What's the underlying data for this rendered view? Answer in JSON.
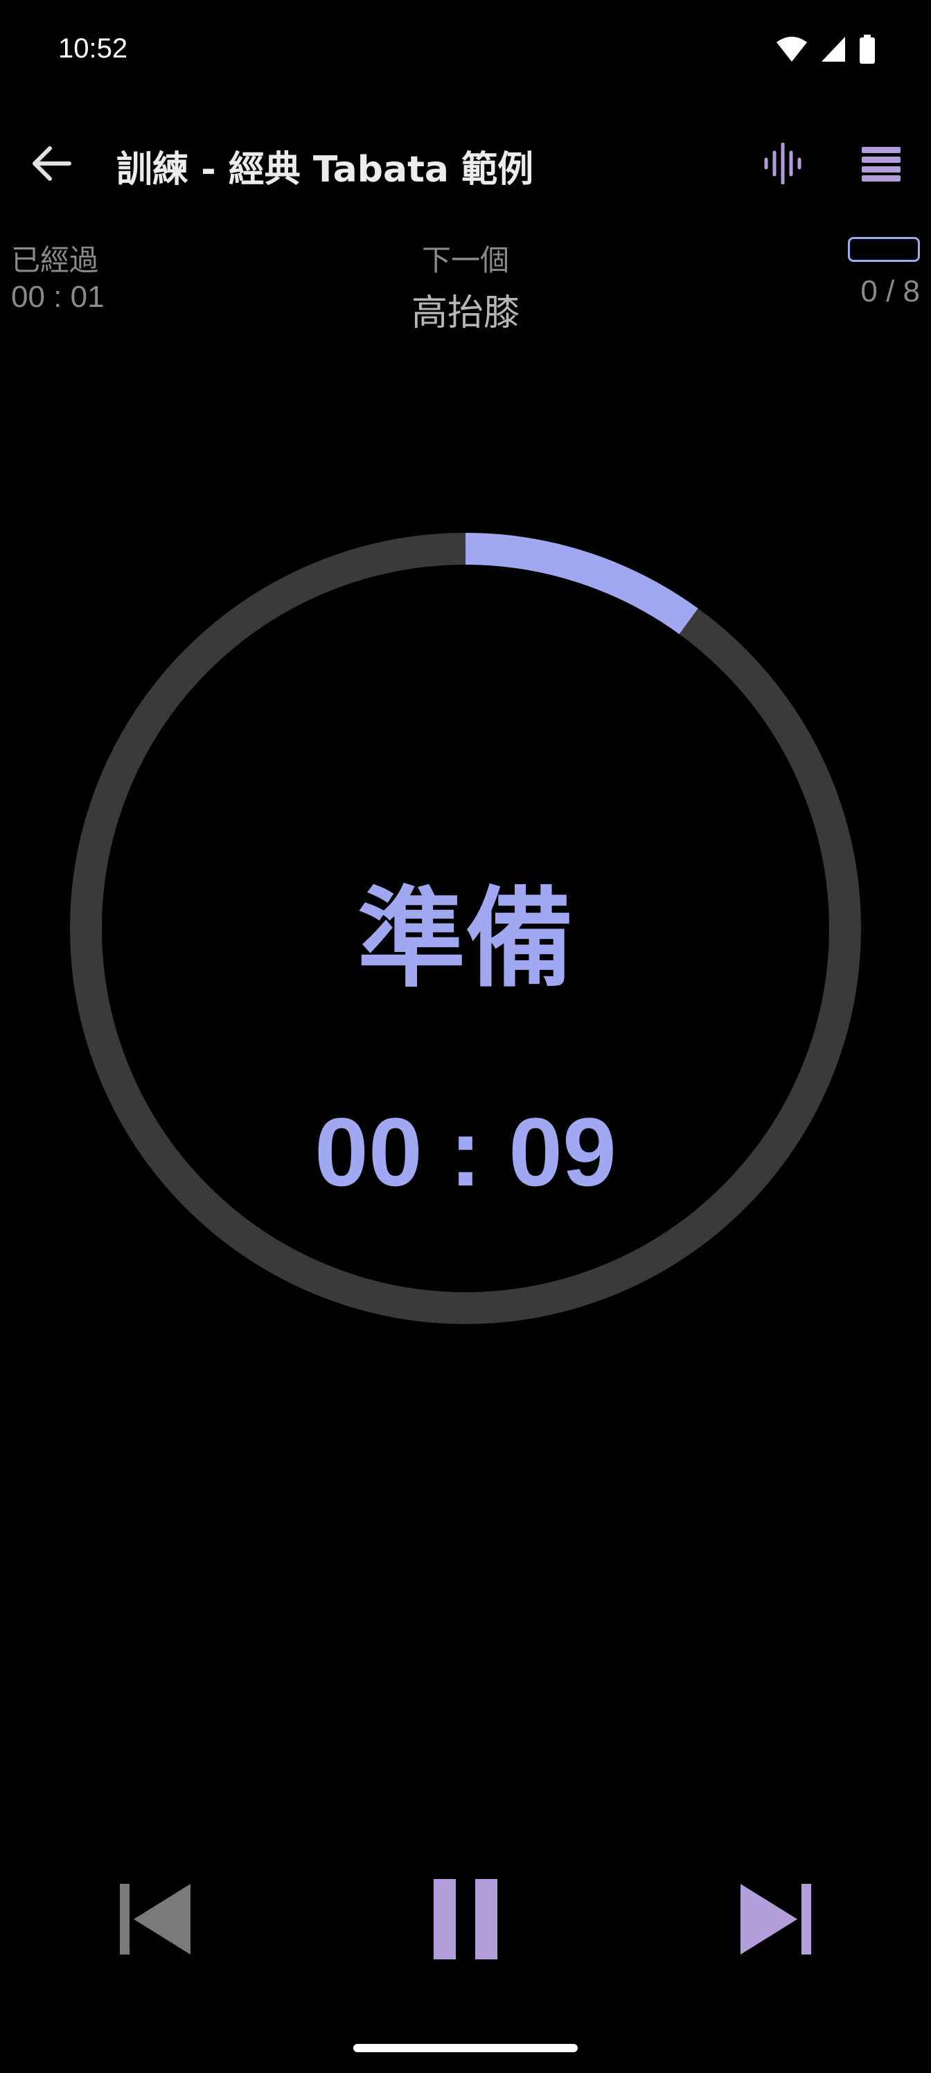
{
  "status_bar": {
    "time": "10:52",
    "icons": [
      "wifi-icon",
      "cellular-signal-icon",
      "battery-icon"
    ]
  },
  "app_bar": {
    "title": "訓練 - 經典 Tabata 範例",
    "icons": [
      "back-arrow-icon",
      "sound-wave-icon",
      "menu-icon"
    ]
  },
  "info": {
    "elapsed_label": "已經過",
    "elapsed_value": "00 : 01",
    "next_label": "下一個",
    "next_value": "高抬膝",
    "rounds": "0 / 8",
    "rounds_progress": 0
  },
  "timer": {
    "phase": "準備",
    "countdown": "00 : 09",
    "progress": 0.1
  },
  "controls": {
    "icons": [
      "skip-previous-icon",
      "pause-icon",
      "skip-next-icon"
    ]
  },
  "colors": {
    "accent": "#9fa8f0",
    "accent_purple": "#b39ddb",
    "track": "#3a3a3a",
    "background": "#000000",
    "muted_text": "#8a8a8a",
    "disabled_icon": "#7a7a7a"
  }
}
